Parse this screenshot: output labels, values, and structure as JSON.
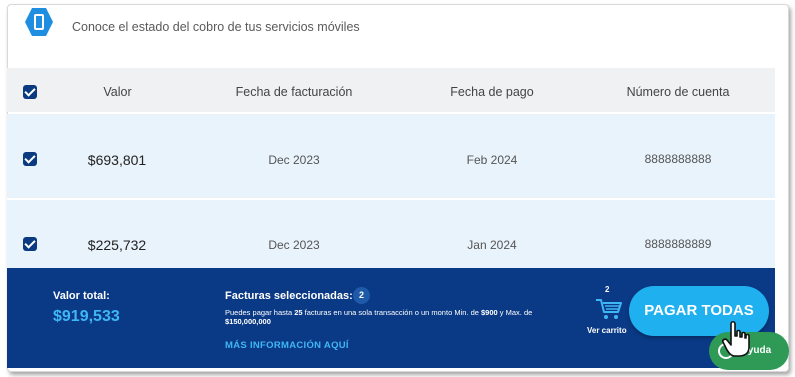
{
  "header": {
    "text": "Conoce el estado del cobro de tus servicios móviles",
    "icon": "mobile-phone-icon"
  },
  "table": {
    "columns": [
      "Valor",
      "Fecha de facturación",
      "Fecha de pago",
      "Número de cuenta"
    ],
    "rows": [
      {
        "valor": "$693,801",
        "fecha_facturacion": "Dec 2023",
        "fecha_pago": "Feb 2024",
        "cuenta": "8888888888"
      },
      {
        "valor": "$225,732",
        "fecha_facturacion": "Dec 2023",
        "fecha_pago": "Jan 2024",
        "cuenta": "8888888889"
      }
    ]
  },
  "footer": {
    "total_label": "Valor total:",
    "total_value": "$919,533",
    "selected_label": "Facturas seleccionadas:",
    "selected_count": "2",
    "note_prefix": "Puedes pagar hasta ",
    "note_max_invoices": "25",
    "note_middle": " facturas en una sola transacción o un monto Min. de ",
    "note_min_amount": "$900",
    "note_and": " y Max. de ",
    "note_max_amount": "$150,000,000",
    "more_info_link": "MÁS INFORMACIÓN AQUÍ",
    "cart_count": "2",
    "cart_label": "Ver carrito",
    "pay_button": "PAGAR TODAS"
  },
  "help": {
    "label": "Ayuda"
  },
  "colors": {
    "primary_dark": "#0a3a86",
    "accent": "#1fb0f0",
    "row_bg": "#e9f3fc",
    "help_green": "#2e9a56"
  }
}
